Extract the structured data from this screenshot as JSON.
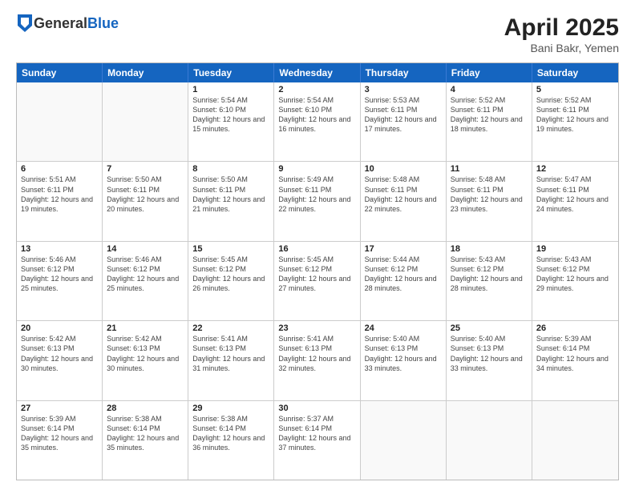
{
  "header": {
    "logo_general": "General",
    "logo_blue": "Blue",
    "title": "April 2025",
    "subtitle": "Bani Bakr, Yemen"
  },
  "calendar": {
    "weekdays": [
      "Sunday",
      "Monday",
      "Tuesday",
      "Wednesday",
      "Thursday",
      "Friday",
      "Saturday"
    ],
    "rows": [
      [
        {
          "day": "",
          "info": ""
        },
        {
          "day": "",
          "info": ""
        },
        {
          "day": "1",
          "info": "Sunrise: 5:54 AM\nSunset: 6:10 PM\nDaylight: 12 hours and 15 minutes."
        },
        {
          "day": "2",
          "info": "Sunrise: 5:54 AM\nSunset: 6:10 PM\nDaylight: 12 hours and 16 minutes."
        },
        {
          "day": "3",
          "info": "Sunrise: 5:53 AM\nSunset: 6:11 PM\nDaylight: 12 hours and 17 minutes."
        },
        {
          "day": "4",
          "info": "Sunrise: 5:52 AM\nSunset: 6:11 PM\nDaylight: 12 hours and 18 minutes."
        },
        {
          "day": "5",
          "info": "Sunrise: 5:52 AM\nSunset: 6:11 PM\nDaylight: 12 hours and 19 minutes."
        }
      ],
      [
        {
          "day": "6",
          "info": "Sunrise: 5:51 AM\nSunset: 6:11 PM\nDaylight: 12 hours and 19 minutes."
        },
        {
          "day": "7",
          "info": "Sunrise: 5:50 AM\nSunset: 6:11 PM\nDaylight: 12 hours and 20 minutes."
        },
        {
          "day": "8",
          "info": "Sunrise: 5:50 AM\nSunset: 6:11 PM\nDaylight: 12 hours and 21 minutes."
        },
        {
          "day": "9",
          "info": "Sunrise: 5:49 AM\nSunset: 6:11 PM\nDaylight: 12 hours and 22 minutes."
        },
        {
          "day": "10",
          "info": "Sunrise: 5:48 AM\nSunset: 6:11 PM\nDaylight: 12 hours and 22 minutes."
        },
        {
          "day": "11",
          "info": "Sunrise: 5:48 AM\nSunset: 6:11 PM\nDaylight: 12 hours and 23 minutes."
        },
        {
          "day": "12",
          "info": "Sunrise: 5:47 AM\nSunset: 6:11 PM\nDaylight: 12 hours and 24 minutes."
        }
      ],
      [
        {
          "day": "13",
          "info": "Sunrise: 5:46 AM\nSunset: 6:12 PM\nDaylight: 12 hours and 25 minutes."
        },
        {
          "day": "14",
          "info": "Sunrise: 5:46 AM\nSunset: 6:12 PM\nDaylight: 12 hours and 25 minutes."
        },
        {
          "day": "15",
          "info": "Sunrise: 5:45 AM\nSunset: 6:12 PM\nDaylight: 12 hours and 26 minutes."
        },
        {
          "day": "16",
          "info": "Sunrise: 5:45 AM\nSunset: 6:12 PM\nDaylight: 12 hours and 27 minutes."
        },
        {
          "day": "17",
          "info": "Sunrise: 5:44 AM\nSunset: 6:12 PM\nDaylight: 12 hours and 28 minutes."
        },
        {
          "day": "18",
          "info": "Sunrise: 5:43 AM\nSunset: 6:12 PM\nDaylight: 12 hours and 28 minutes."
        },
        {
          "day": "19",
          "info": "Sunrise: 5:43 AM\nSunset: 6:12 PM\nDaylight: 12 hours and 29 minutes."
        }
      ],
      [
        {
          "day": "20",
          "info": "Sunrise: 5:42 AM\nSunset: 6:13 PM\nDaylight: 12 hours and 30 minutes."
        },
        {
          "day": "21",
          "info": "Sunrise: 5:42 AM\nSunset: 6:13 PM\nDaylight: 12 hours and 30 minutes."
        },
        {
          "day": "22",
          "info": "Sunrise: 5:41 AM\nSunset: 6:13 PM\nDaylight: 12 hours and 31 minutes."
        },
        {
          "day": "23",
          "info": "Sunrise: 5:41 AM\nSunset: 6:13 PM\nDaylight: 12 hours and 32 minutes."
        },
        {
          "day": "24",
          "info": "Sunrise: 5:40 AM\nSunset: 6:13 PM\nDaylight: 12 hours and 33 minutes."
        },
        {
          "day": "25",
          "info": "Sunrise: 5:40 AM\nSunset: 6:13 PM\nDaylight: 12 hours and 33 minutes."
        },
        {
          "day": "26",
          "info": "Sunrise: 5:39 AM\nSunset: 6:14 PM\nDaylight: 12 hours and 34 minutes."
        }
      ],
      [
        {
          "day": "27",
          "info": "Sunrise: 5:39 AM\nSunset: 6:14 PM\nDaylight: 12 hours and 35 minutes."
        },
        {
          "day": "28",
          "info": "Sunrise: 5:38 AM\nSunset: 6:14 PM\nDaylight: 12 hours and 35 minutes."
        },
        {
          "day": "29",
          "info": "Sunrise: 5:38 AM\nSunset: 6:14 PM\nDaylight: 12 hours and 36 minutes."
        },
        {
          "day": "30",
          "info": "Sunrise: 5:37 AM\nSunset: 6:14 PM\nDaylight: 12 hours and 37 minutes."
        },
        {
          "day": "",
          "info": ""
        },
        {
          "day": "",
          "info": ""
        },
        {
          "day": "",
          "info": ""
        }
      ]
    ]
  }
}
